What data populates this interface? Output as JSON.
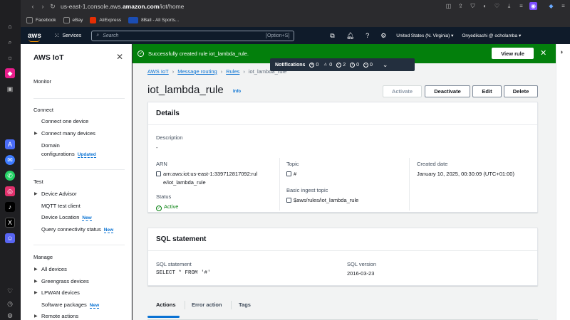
{
  "browser": {
    "url_prefix": "us-east-1.console.aws.",
    "url_domain": "amazon.com",
    "url_path": "/iot/home",
    "bookmarks": [
      "Facebook",
      "eBay",
      "AliExpress",
      "8Ball - All Sports..."
    ]
  },
  "aws_nav": {
    "logo": "aws",
    "services_label": "Services",
    "search_placeholder": "Search",
    "search_shortcut": "[Option+S]",
    "region": "United States (N. Virginia) ▾",
    "user": "Onyedikachi @ ocholamba ▾"
  },
  "sidebar": {
    "title": "AWS IoT",
    "monitor": "Monitor",
    "connect_heading": "Connect",
    "connect_one": "Connect one device",
    "connect_many": "Connect many devices",
    "domain_config_1": "Domain",
    "domain_config_2": "configurations",
    "updated_badge": "Updated",
    "test_heading": "Test",
    "device_advisor": "Device Advisor",
    "mqtt_client": "MQTT test client",
    "device_location": "Device Location",
    "query_status": "Query connectivity status",
    "new_badge": "New",
    "manage_heading": "Manage",
    "all_devices": "All devices",
    "greengrass": "Greengrass devices",
    "lpwan": "LPWAN devices",
    "software_packages": "Software packages",
    "remote_actions": "Remote actions"
  },
  "flash": {
    "message": "Successfully created rule iot_lambda_rule.",
    "button": "View rule"
  },
  "notifications": {
    "title": "Notifications",
    "errors": "0",
    "warnings": "0",
    "success": "2",
    "info": "0",
    "in_progress": "0"
  },
  "breadcrumb": {
    "items": [
      "AWS IoT",
      "Message routing",
      "Rules"
    ],
    "current": "iot_lambda_rule"
  },
  "page": {
    "title": "iot_lambda_rule",
    "info": "Info",
    "btn_activate": "Activate",
    "btn_deactivate": "Deactivate",
    "btn_edit": "Edit",
    "btn_delete": "Delete"
  },
  "details": {
    "heading": "Details",
    "description_label": "Description",
    "description_value": "-",
    "arn_label": "ARN",
    "arn_line1": "arn:aws:iot:us-east-1:339712817092:rul",
    "arn_line2": "e/iot_lambda_rule",
    "status_label": "Status",
    "status_value": "Active",
    "topic_label": "Topic",
    "topic_value": "#",
    "basic_ingest_label": "Basic ingest topic",
    "basic_ingest_value": "$aws/rules/iot_lambda_rule",
    "created_label": "Created date",
    "created_value": "January 10, 2025, 00:30:09 (UTC+01:00)"
  },
  "sql": {
    "heading": "SQL statement",
    "statement_label": "SQL statement",
    "statement_value": "SELECT * FROM '#'",
    "version_label": "SQL version",
    "version_value": "2016-03-23"
  },
  "tabs": [
    "Actions",
    "Error action",
    "Tags"
  ],
  "colors": {
    "success_green": "#037f0c",
    "link_blue": "#0972d3",
    "aws_nav": "#0f1b2a",
    "aws_orange": "#ff9900"
  }
}
